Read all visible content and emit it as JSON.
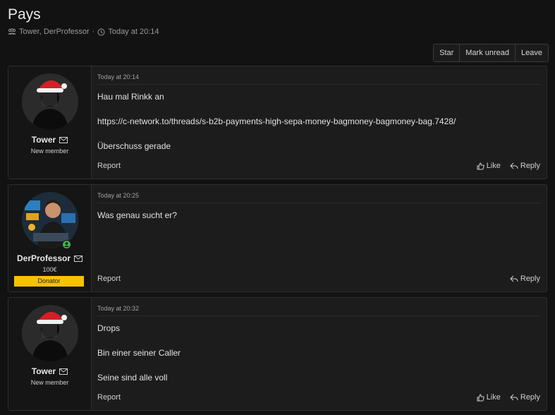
{
  "thread": {
    "title": "Pays",
    "participants": "Tower, DerProfessor",
    "separator": "·",
    "time": "Today at 20:14"
  },
  "actions": {
    "star": "Star",
    "mark_unread": "Mark unread",
    "leave": "Leave"
  },
  "messages": [
    {
      "user": {
        "name": "Tower",
        "title": "New member"
      },
      "time": "Today at 20:14",
      "lines": [
        "Hau mal Rinkk an",
        "https://c-network.to/threads/s-b2b-payments-high-sepa-money-bagmoney-bagmoney-bag.7428/",
        "Überschuss gerade"
      ],
      "report": "Report",
      "like": "Like",
      "reply": "Reply"
    },
    {
      "user": {
        "name": "DerProfessor",
        "extra": "100€",
        "badge": "Donator"
      },
      "time": "Today at 20:25",
      "lines": [
        "Was genau sucht er?"
      ],
      "report": "Report",
      "reply": "Reply"
    },
    {
      "user": {
        "name": "Tower",
        "title": "New member"
      },
      "time": "Today at 20:32",
      "lines": [
        "Drops",
        "Bin einer seiner Caller",
        "Seine sind alle voll"
      ],
      "report": "Report",
      "like": "Like",
      "reply": "Reply"
    }
  ],
  "colors": {
    "background": "#121212",
    "panel": "#1c1c1c",
    "badge": "#f5c300",
    "online": "#3bb54a",
    "santa_hat": "#d51f26"
  }
}
